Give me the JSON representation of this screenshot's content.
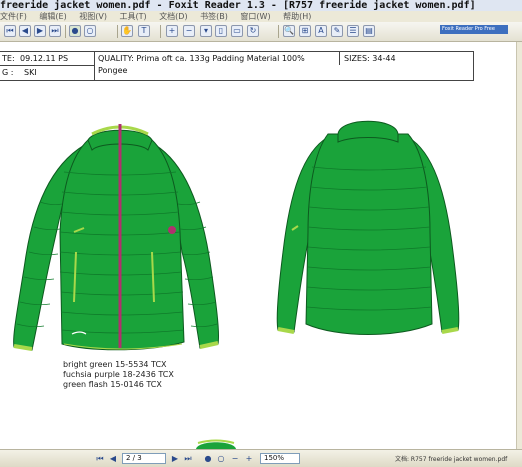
{
  "window": {
    "title": "freeride jacket women.pdf - Foxit Reader 1.3 - [R757  freeride jacket women.pdf]"
  },
  "menu": {
    "items": [
      "文件(F)",
      "编辑(E)",
      "视图(V)",
      "工具(T)",
      "文档(D)",
      "书签(B)",
      "窗口(W)",
      "帮助(H)"
    ]
  },
  "toolbar": {
    "promo_label": "Foxit Reader Pro  Free"
  },
  "document": {
    "header": {
      "date_label": "TE:",
      "date_value": "09.12.11 PS",
      "category_label": "G :",
      "category_value": "SKI",
      "quality_line1": "QUALITY: Prima oft ca. 133g Padding Material 100%",
      "quality_line2": "Pongee",
      "sizes": "SIZES: 34-44"
    },
    "color_notes": [
      "bright green 15-5534 TCX",
      "fuchsia purple 18-2436 TCX",
      "green flash 15-0146 TCX"
    ]
  },
  "statusbar": {
    "page_value": "2 / 3",
    "zoom_value": "150%",
    "doc_label": "文档: R757  freeride jacket women.pdf"
  },
  "colors": {
    "jacket_green": "#1aa33a",
    "zipper_fuchsia": "#b0306e",
    "trim_green_flash": "#a8d84a"
  }
}
